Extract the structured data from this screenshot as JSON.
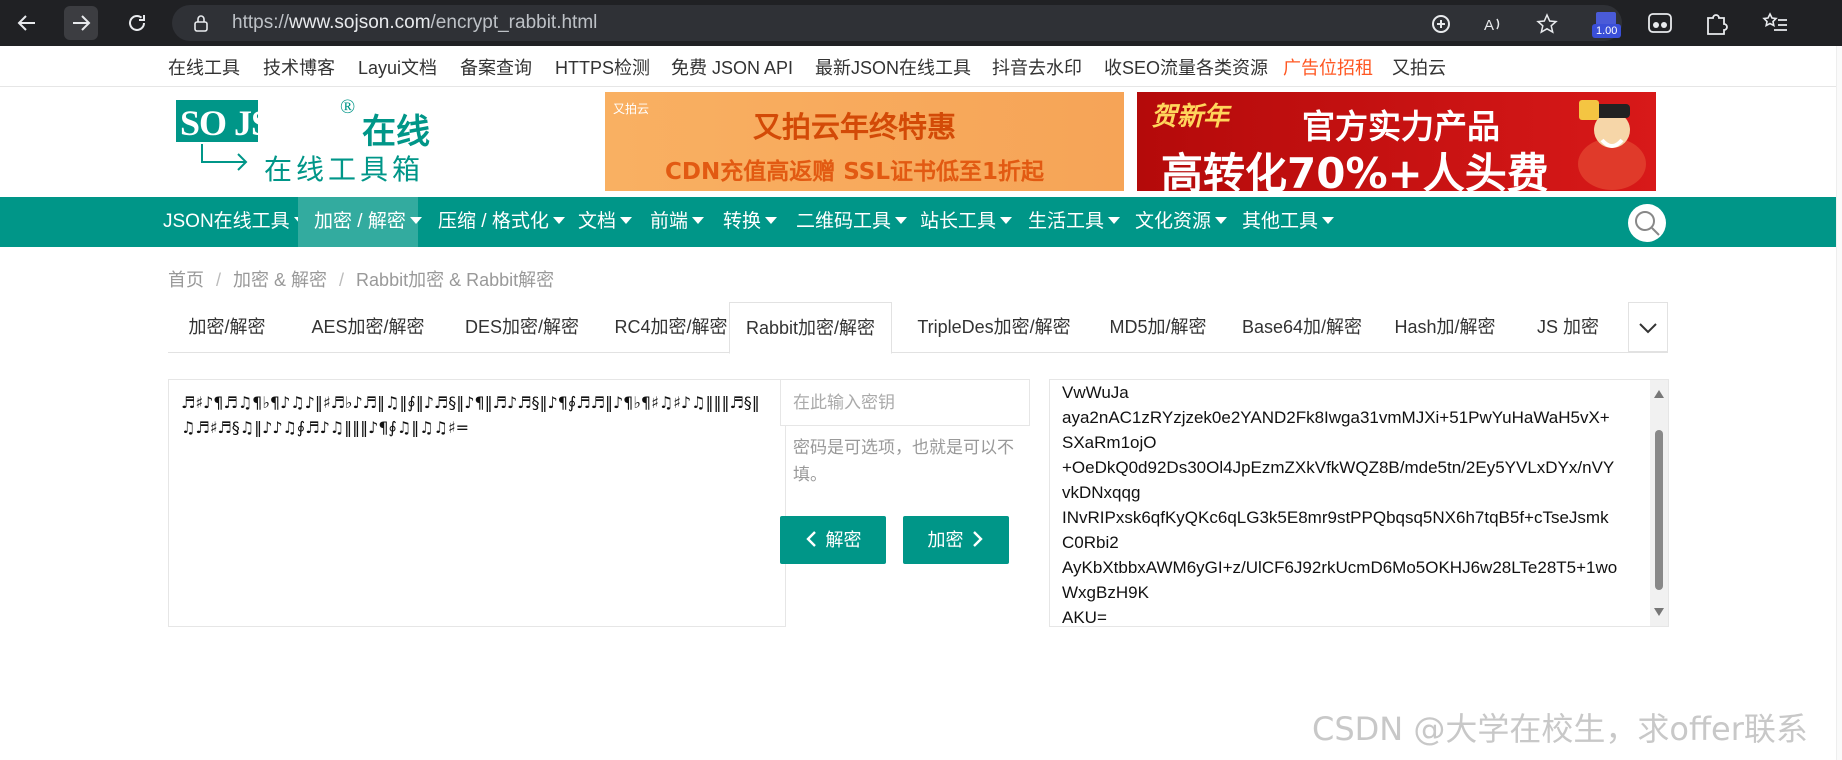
{
  "browser": {
    "url_prefix": "https://",
    "url_domain": "www.sojson.com",
    "url_path": "/encrypt_rabbit.html",
    "zoom_badge": "1.00"
  },
  "top_links": [
    {
      "label": "在线工具"
    },
    {
      "label": "技术博客"
    },
    {
      "label": "Layui文档"
    },
    {
      "label": "备案查询"
    },
    {
      "label": "HTTPS检测"
    },
    {
      "label": "免费 JSON API"
    },
    {
      "label": "最新JSON在线工具"
    },
    {
      "label": "抖音去水印"
    },
    {
      "label": "收SEO流量各类资源"
    },
    {
      "label": "广告位招租"
    },
    {
      "label": "又拍云"
    }
  ],
  "logo": {
    "brand": "SO JSON",
    "mark": "®",
    "online": "在线",
    "subtitle": "在线工具箱"
  },
  "banner1": {
    "tag": "又拍云",
    "title": "又拍云年终特惠",
    "subtitle": "CDN充值高返赠   SSL证书低至1折起"
  },
  "banner2": {
    "left": "贺新年",
    "title": "官方实力产品",
    "subtitle": "高转化70%+人头费"
  },
  "main_nav": [
    {
      "label": "JSON在线工具"
    },
    {
      "label": "加密 / 解密"
    },
    {
      "label": "压缩 / 格式化"
    },
    {
      "label": "文档"
    },
    {
      "label": "前端"
    },
    {
      "label": "转换"
    },
    {
      "label": "二维码工具"
    },
    {
      "label": "站长工具"
    },
    {
      "label": "生活工具"
    },
    {
      "label": "文化资源"
    },
    {
      "label": "其他工具"
    }
  ],
  "breadcrumb": {
    "home": "首页",
    "section": "加密 & 解密",
    "current": "Rabbit加密 & Rabbit解密",
    "separator": "/"
  },
  "tabs": [
    {
      "label": "加密/解密"
    },
    {
      "label": "AES加密/解密"
    },
    {
      "label": "DES加密/解密"
    },
    {
      "label": "RC4加密/解密"
    },
    {
      "label": "Rabbit加密/解密"
    },
    {
      "label": "TripleDes加密/解密"
    },
    {
      "label": "MD5加/解密"
    },
    {
      "label": "Base64加/解密"
    },
    {
      "label": "Hash加/解密"
    },
    {
      "label": "JS 加密"
    }
  ],
  "input_text": "♬♯♪¶♬♫¶♭¶♪♫♪‖♯♬♭♪♬‖♫‖∮‖♪♬§‖♪¶‖♬♪♬§‖♪¶∮♬♬‖♪¶♭¶♯♫♯♪♫‖‖‖♬§‖♫♬♯♬§♫‖♪♪♫∮♬♪♫‖‖‖♪¶∮♫‖♫♫♯=",
  "key_placeholder": "在此输入密钥",
  "key_hint": "密码是可选项，也就是可以不填。",
  "decrypt_label": "解密",
  "encrypt_label": "加密",
  "output_lines": [
    "VwWuJa",
    "aya2nAC1zRYzjzek0e2YAND2Fk8Iwga31vmMJXi+51PwYuHaWaH5vX+",
    "SXaRm1ojO",
    "+OeDkQ0d92Ds30Ol4JpEzmZXkVfkWQZ8B/mde5tn/2Ey5YVLxDYx/nVY",
    "vkDNxqqg",
    "INvRIPxsk6qfKyQKc6qLG3k5E8mr9stPPQbqsq5NX6h7tqB5f+cTseJsmk",
    "C0Rbi2",
    "AyKbXtbbxAWM6yGI+z/UlCF6J92rkUcmD6Mo5OKHJ6w28LTe28T5+1wo",
    "WxgBzH9K",
    "AKU="
  ],
  "watermark": "CSDN @大学在校生，求offer联系",
  "colors": {
    "brand_green": "#009688",
    "highlight_red": "#ff5722"
  }
}
